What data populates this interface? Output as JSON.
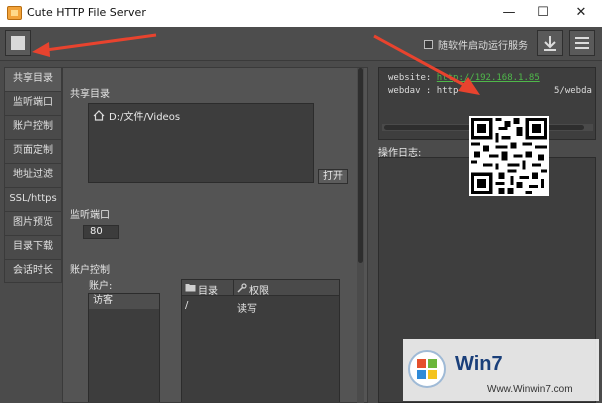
{
  "window": {
    "title": "Cute HTTP File Server",
    "minimize_glyph": "—",
    "maximize_glyph": "☐",
    "close_glyph": "✕"
  },
  "toolbar": {
    "auto_start_label": "随软件启动运行服务",
    "auto_start_checked": false,
    "stop_icon": "stop-square-icon",
    "download_icon": "download-icon",
    "menu_icon": "hamburger-menu-icon"
  },
  "tabs": [
    {
      "label": "共享目录",
      "active": true
    },
    {
      "label": "监听端口",
      "active": false
    },
    {
      "label": "账户控制",
      "active": false
    },
    {
      "label": "页面定制",
      "active": false
    },
    {
      "label": "地址过滤",
      "active": false
    },
    {
      "label": "SSL/https",
      "active": false
    },
    {
      "label": "图片预览",
      "active": false
    },
    {
      "label": "目录下载",
      "active": false
    },
    {
      "label": "会话时长",
      "active": false
    }
  ],
  "shared_dir": {
    "heading": "共享目录",
    "folder_path": "D:/文件/Videos",
    "open_button": "打开"
  },
  "listen_port": {
    "heading": "监听端口",
    "value": "80"
  },
  "account_control": {
    "heading": "账户控制",
    "account_label": "账户:",
    "accounts": [
      "访客"
    ],
    "permission_columns": [
      "目录",
      "权限"
    ],
    "permission_rows": [
      {
        "dir": "/",
        "perm": "读写"
      }
    ]
  },
  "urls": {
    "website_label": "website:",
    "website_url": "http://192.168.1.85",
    "webdav_label": "webdav :",
    "webdav_url_start": "http",
    "webdav_url_end": "5/webda"
  },
  "log": {
    "heading": "操作日志:"
  },
  "watermark": {
    "logo_text": "Win7",
    "site": "Www.Winwin7.com"
  },
  "colors": {
    "app_background": "#4b4b4b",
    "url_link": "#4fb84a",
    "arrow": "#e8432e",
    "app_icon": "#f2a33a"
  }
}
